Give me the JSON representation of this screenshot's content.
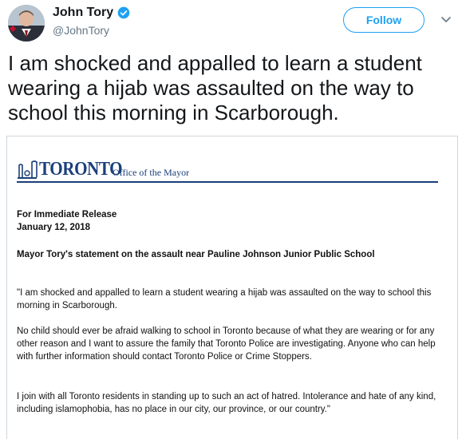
{
  "author": {
    "display_name": "John Tory",
    "handle": "@JohnTory",
    "verified": true
  },
  "actions": {
    "follow_label": "Follow"
  },
  "tweet": {
    "text": "I am shocked and appalled to learn a student wearing a hijab was assaulted on the way to school this morning in Scarborough."
  },
  "document": {
    "logo_text": "TORONTO",
    "office": "Office of the Mayor",
    "release_label": "For Immediate Release",
    "date": "January 12, 2018",
    "headline": "Mayor Tory's statement on the assault near Pauline Johnson Junior Public School",
    "paragraphs": [
      "\"I am shocked and appalled to learn a student wearing a hijab was assaulted on the way to school this morning in Scarborough.",
      "No child should ever be afraid walking to school in Toronto because of what they are wearing or for any other reason and I want to assure the family that Toronto Police are investigating. Anyone who can help with further information should contact Toronto Police or Crime Stoppers.",
      "I join with all Toronto residents in standing up to such an act of hatred. Intolerance and hate of any kind, including islamophobia, has no place in our city, our province, or our country.\""
    ]
  },
  "colors": {
    "accent": "#1da1f2",
    "text_primary": "#14171a",
    "text_secondary": "#657786",
    "toronto_blue": "#1a3f7a"
  }
}
